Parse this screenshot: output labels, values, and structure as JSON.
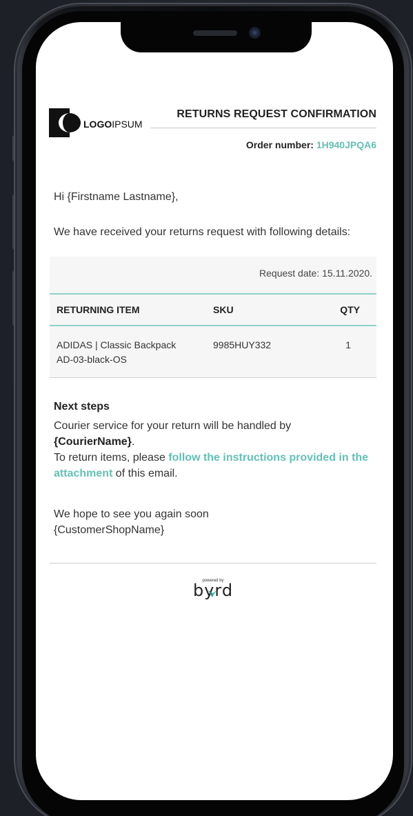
{
  "header": {
    "logo_bold": "LOGO",
    "logo_light": "IPSUM",
    "title": "RETURNS REQUEST CONFIRMATION",
    "order_label": "Order number:",
    "order_number": "1H940JPQA6"
  },
  "body": {
    "greeting": "Hi {Firstname Lastname},",
    "intro": "We have received your returns request with following details:"
  },
  "request": {
    "date_label": "Request date: 15.11.2020.",
    "columns": [
      "RETURNING ITEM",
      "SKU",
      "QTY"
    ],
    "rows": [
      {
        "item_line1": "ADIDAS | Classic Backpack",
        "item_line2": "AD-03-black-OS",
        "sku": "9985HUY332",
        "qty": "1"
      }
    ]
  },
  "next_steps": {
    "title": "Next steps",
    "line1": "Courier service for your return will be handled by",
    "courier": "{CourierName}",
    "courier_suffix": ".",
    "line2_prefix": "To return items, please ",
    "link_text": "follow the instructions provided in the attachment",
    "line2_suffix": " of this email."
  },
  "closing": {
    "line1": "We hope to see you again soon",
    "line2": "{CustomerShopName}"
  },
  "footer": {
    "powered_by": "powered by",
    "brand": "byrd"
  },
  "colors": {
    "accent": "#63c1b5",
    "accent_rule": "#8fd2c8",
    "panel": "#f6f6f6",
    "text": "#333333"
  }
}
